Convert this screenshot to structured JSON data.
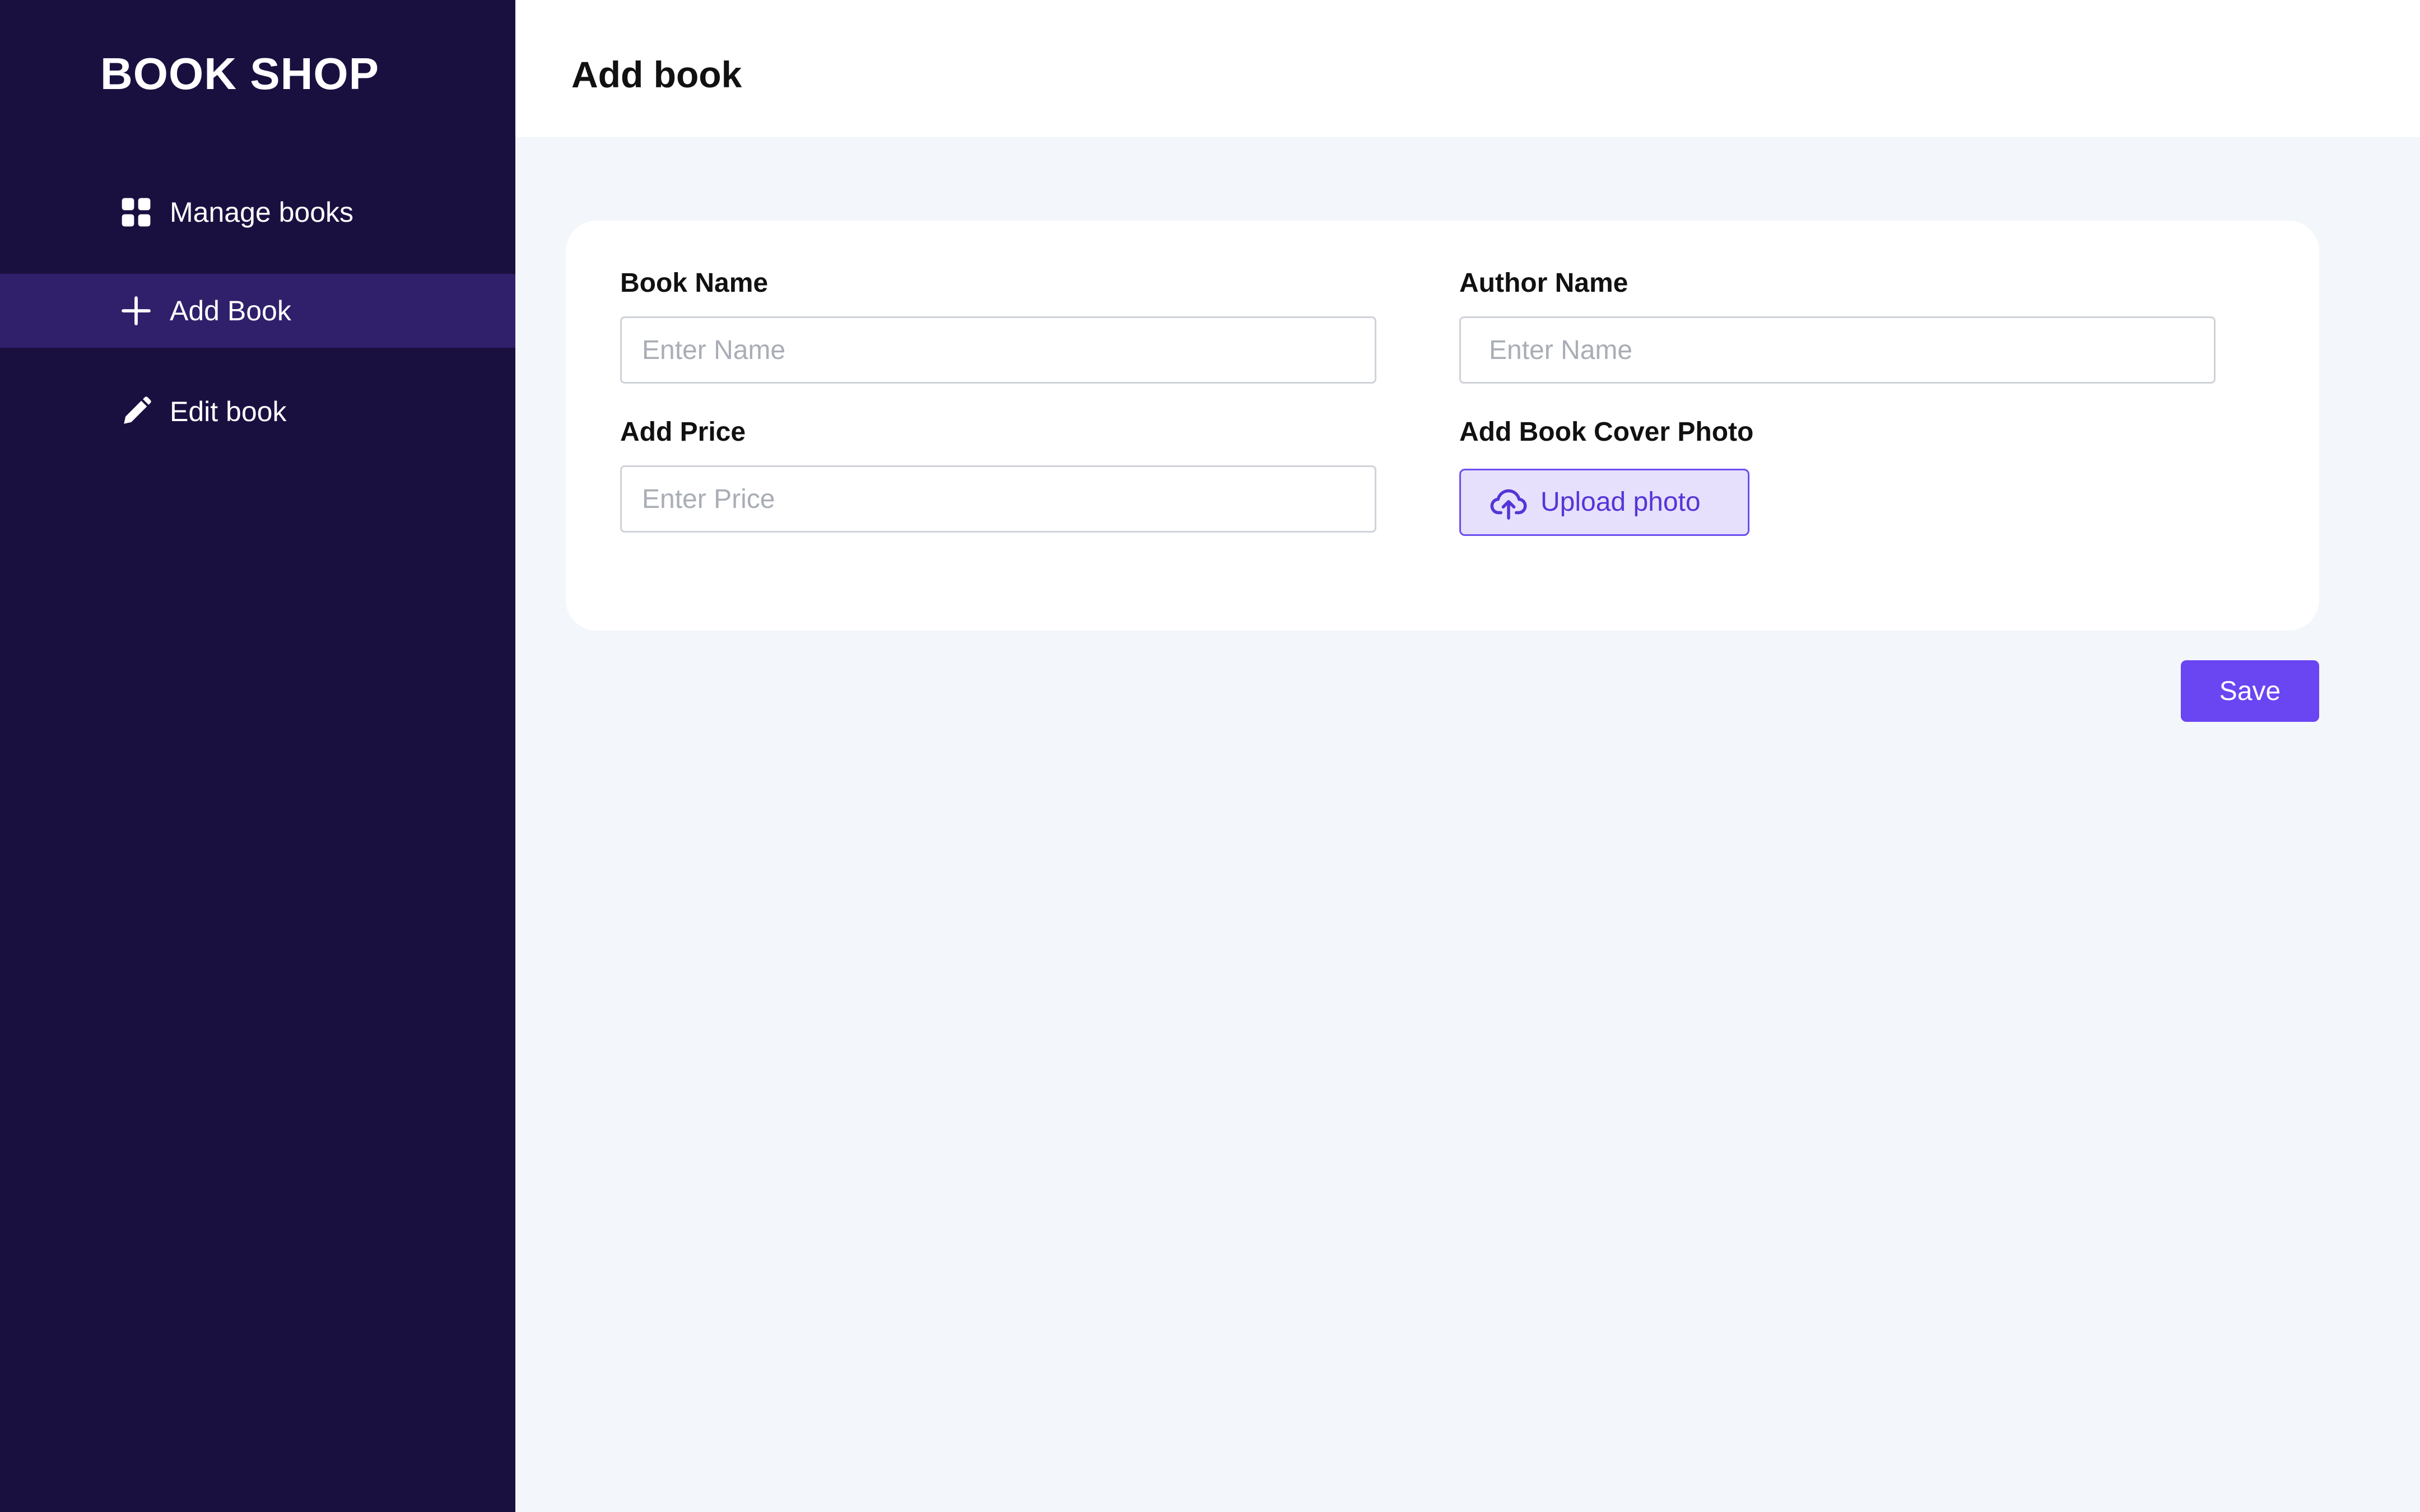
{
  "app": {
    "brand": "BOOK SHOP"
  },
  "sidebar": {
    "items": [
      {
        "label": "Manage books",
        "icon": "grid-icon",
        "active": false
      },
      {
        "label": "Add Book",
        "icon": "plus-icon",
        "active": true
      },
      {
        "label": "Edit book",
        "icon": "pencil-icon",
        "active": false
      }
    ]
  },
  "header": {
    "title": "Add book"
  },
  "form": {
    "book_name": {
      "label": "Book Name",
      "value": "",
      "placeholder": "Enter Name"
    },
    "author_name": {
      "label": "Author Name",
      "value": "",
      "placeholder": "Enter Name"
    },
    "price": {
      "label": "Add Price",
      "value": "",
      "placeholder": "Enter Price"
    },
    "cover_photo": {
      "label": "Add Book Cover Photo",
      "button_label": "Upload photo",
      "icon": "cloud-upload-icon"
    }
  },
  "actions": {
    "save_label": "Save"
  },
  "colors": {
    "sidebar_bg": "#1a1040",
    "sidebar_active_bg": "#30206b",
    "page_bg": "#f3f6fa",
    "accent": "#6a45f2",
    "upload_bg": "#e6e0fc"
  }
}
